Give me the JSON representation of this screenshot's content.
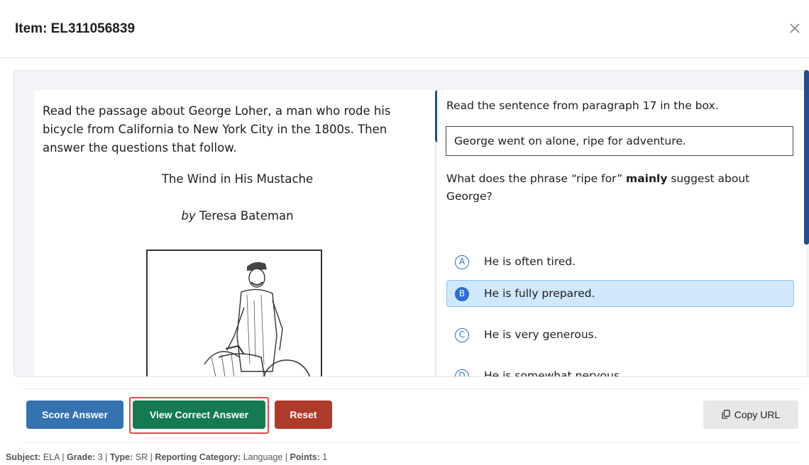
{
  "header": {
    "title": "Item: EL311056839",
    "close_icon": "close-icon"
  },
  "passage": {
    "intro": "Read the passage about George Loher, a man who rode his bicycle from California to New York City in the 1800s. Then answer the questions that follow.",
    "title": "The Wind in His Mustache",
    "author_prefix": "by",
    "author_name": "Teresa Bateman",
    "illustration_icon": "man-with-bicycle-illustration"
  },
  "question": {
    "stem_intro": "Read the sentence from paragraph 17 in the box.",
    "boxed_sentence": "George went on alone, ripe for adventure.",
    "stem_part1": "What does the phrase “ripe for” ",
    "stem_emphasis": "mainly",
    "stem_part2": " suggest about George?",
    "options": [
      {
        "letter": "A",
        "text": "He is often tired.",
        "selected": false
      },
      {
        "letter": "B",
        "text": "He is fully prepared.",
        "selected": true
      },
      {
        "letter": "C",
        "text": "He is very generous.",
        "selected": false
      },
      {
        "letter": "D",
        "text": "He is somewhat nervous.",
        "selected": false
      }
    ]
  },
  "buttons": {
    "score": "Score Answer",
    "view_correct": "View Correct Answer",
    "reset": "Reset",
    "copy_url": "Copy URL"
  },
  "meta": {
    "subject_label": "Subject:",
    "subject": "ELA",
    "grade_label": "Grade:",
    "grade": "3",
    "type_label": "Type:",
    "type": "SR",
    "reporting_label": "Reporting Category:",
    "reporting": "Language",
    "points_label": "Points:",
    "points": "1"
  },
  "colors": {
    "score": "#3572b0",
    "view_correct": "#137a52",
    "reset": "#b03a2a",
    "highlight_outline": "#e04b4b",
    "selected_option_bg": "#cfe8fb",
    "scrollbar": "#1f4e8c"
  }
}
